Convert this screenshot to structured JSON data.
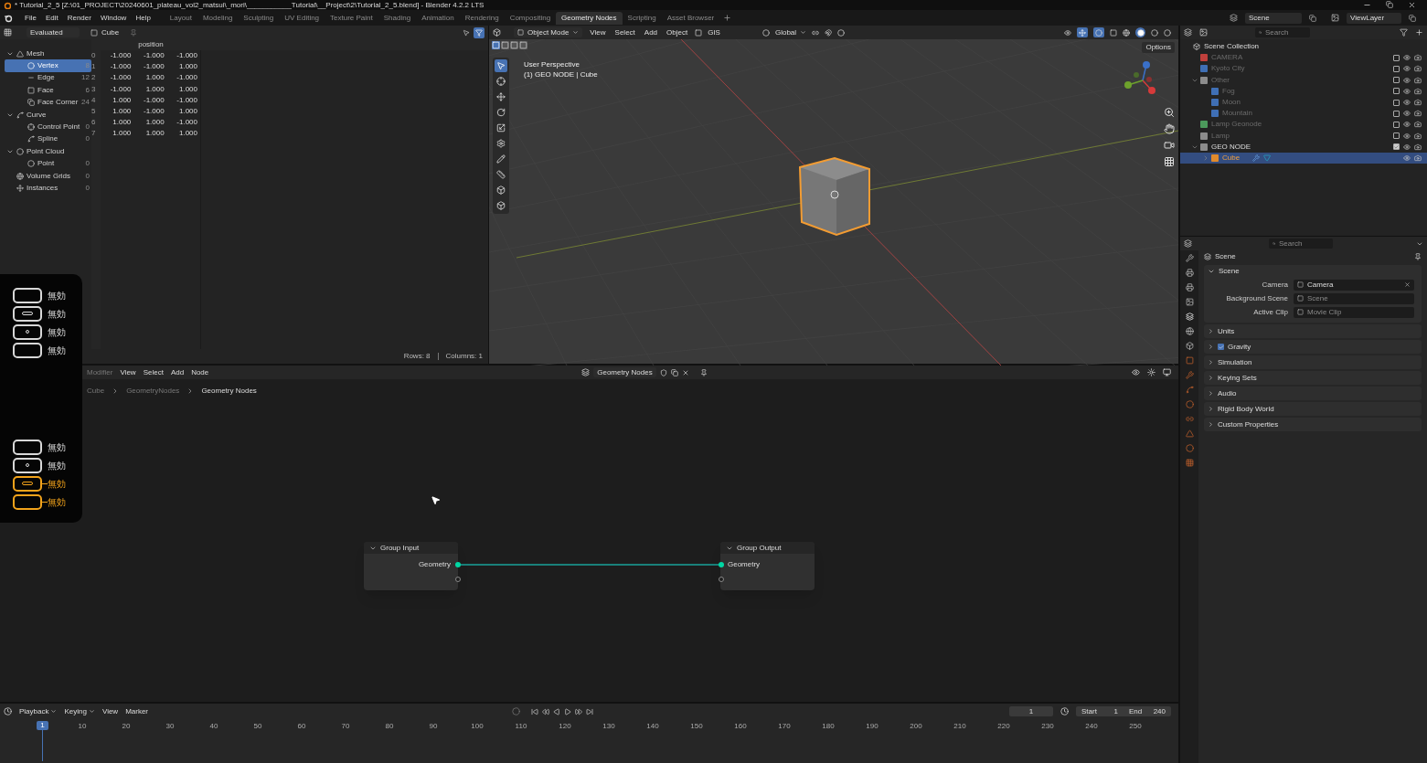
{
  "title_bar": {
    "title": "* Tutorial_2_5 [Z:\\01_PROJECT\\20240601_plateau_vol2_matsui\\_mori\\___________Tutorial\\__Project\\2\\Tutorial_2_5.blend] - Blender 4.2.2 LTS"
  },
  "menu": [
    "File",
    "Edit",
    "Render",
    "Window",
    "Help"
  ],
  "workspaces": [
    {
      "label": "Layout",
      "selected": false
    },
    {
      "label": "Modeling",
      "selected": false
    },
    {
      "label": "Sculpting",
      "selected": false
    },
    {
      "label": "UV Editing",
      "selected": false
    },
    {
      "label": "Texture Paint",
      "selected": false
    },
    {
      "label": "Shading",
      "selected": false
    },
    {
      "label": "Animation",
      "selected": false
    },
    {
      "label": "Rendering",
      "selected": false
    },
    {
      "label": "Compositing",
      "selected": false
    },
    {
      "label": "Geometry Nodes",
      "selected": true
    },
    {
      "label": "Scripting",
      "selected": false
    },
    {
      "label": "Asset Browser",
      "selected": false
    }
  ],
  "scene_field": "Scene",
  "view_layer_field": "ViewLayer",
  "spreadsheet": {
    "mode": "Evaluated",
    "object": "Cube",
    "tree": [
      {
        "label": "Mesh",
        "kind": "mesh",
        "selected": false,
        "expanded": true,
        "children": [
          {
            "label": "Vertex",
            "kind": "vertex",
            "count": "8",
            "selected": true
          },
          {
            "label": "Edge",
            "kind": "edge",
            "count": "12",
            "selected": false
          },
          {
            "label": "Face",
            "kind": "face",
            "count": "6",
            "selected": false
          },
          {
            "label": "Face Corner",
            "kind": "corner",
            "count": "24",
            "selected": false
          }
        ]
      },
      {
        "label": "Curve",
        "kind": "curve",
        "selected": false,
        "expanded": true,
        "children": [
          {
            "label": "Control Point",
            "kind": "control",
            "count": "0",
            "selected": false
          },
          {
            "label": "Spline",
            "kind": "spline",
            "count": "0",
            "selected": false
          }
        ]
      },
      {
        "label": "Point Cloud",
        "kind": "pointcloud",
        "selected": false,
        "expanded": true,
        "children": [
          {
            "label": "Point",
            "kind": "point",
            "count": "0",
            "selected": false
          }
        ]
      },
      {
        "label": "Volume Grids",
        "kind": "volume",
        "count": "0",
        "selected": false
      },
      {
        "label": "Instances",
        "kind": "instances",
        "count": "0",
        "selected": false
      }
    ],
    "column": "position",
    "rows": [
      {
        "index": "0",
        "values": [
          "-1.000",
          "-1.000",
          "-1.000"
        ]
      },
      {
        "index": "1",
        "values": [
          "-1.000",
          "-1.000",
          "1.000"
        ]
      },
      {
        "index": "2",
        "values": [
          "-1.000",
          "1.000",
          "-1.000"
        ]
      },
      {
        "index": "3",
        "values": [
          "-1.000",
          "1.000",
          "1.000"
        ]
      },
      {
        "index": "4",
        "values": [
          "1.000",
          "-1.000",
          "-1.000"
        ]
      },
      {
        "index": "5",
        "values": [
          "1.000",
          "-1.000",
          "1.000"
        ]
      },
      {
        "index": "6",
        "values": [
          "1.000",
          "1.000",
          "-1.000"
        ]
      },
      {
        "index": "7",
        "values": [
          "1.000",
          "1.000",
          "1.000"
        ]
      }
    ],
    "rows_status": "Rows: 8",
    "columns_status": "Columns: 1"
  },
  "viewport": {
    "mode": "Object Mode",
    "menus": [
      "View",
      "Select",
      "Add",
      "Object"
    ],
    "gis": "GIS",
    "orientation": "Global",
    "options": "Options",
    "info": [
      "User Perspective",
      "(1) GEO NODE | Cube"
    ]
  },
  "input_overlay": {
    "groups": [
      [
        {
          "kind": "blank",
          "label": "無効",
          "active": false
        },
        {
          "kind": "dash",
          "label": "無効",
          "active": false
        },
        {
          "kind": "dot",
          "label": "無効",
          "active": false
        },
        {
          "kind": "blank",
          "label": "無効",
          "active": false
        }
      ],
      [
        {
          "kind": "blank",
          "label": "無効",
          "active": false
        },
        {
          "kind": "dot",
          "label": "無効",
          "active": false
        },
        {
          "kind": "dash",
          "label": "無効",
          "active": true
        },
        {
          "kind": "blank",
          "label": "無効",
          "active": true
        }
      ]
    ]
  },
  "node_editor": {
    "modifier": "Modifier",
    "menus": [
      "View",
      "Select",
      "Add",
      "Node"
    ],
    "tree_name": "Geometry Nodes",
    "breadcrumb": [
      "Cube",
      "GeometryNodes",
      "Geometry Nodes"
    ],
    "nodes": [
      {
        "title": "Group Input",
        "socket": "Geometry",
        "kind": "input"
      },
      {
        "title": "Group Output",
        "socket": "Geometry",
        "kind": "output"
      }
    ]
  },
  "outliner": {
    "search_placeholder": "Search",
    "root": "Scene Collection",
    "items": [
      {
        "name": "CAMERA",
        "kind": "collection",
        "color": "#c0403c",
        "checked": false,
        "selected": false
      },
      {
        "name": "Kyoto City",
        "kind": "collection",
        "color": "#3f6fb5",
        "checked": false,
        "selected": false
      },
      {
        "name": "Other",
        "kind": "collection",
        "color": "#8c8c8c",
        "checked": false,
        "selected": false,
        "expanded": true,
        "children": [
          {
            "name": "Fog",
            "kind": "collection",
            "color": "#3f6fb5",
            "checked": false,
            "selected": false
          },
          {
            "name": "Moon",
            "kind": "collection",
            "color": "#3f6fb5",
            "checked": false,
            "selected": false
          },
          {
            "name": "Mountain",
            "kind": "collection",
            "color": "#3f6fb5",
            "checked": false,
            "selected": false
          }
        ]
      },
      {
        "name": "Lamp Geonode",
        "kind": "collection",
        "color": "#4c9a5c",
        "checked": false,
        "selected": false
      },
      {
        "name": "Lamp",
        "kind": "collection",
        "color": "#8c8c8c",
        "checked": false,
        "selected": false
      },
      {
        "name": "GEO NODE",
        "kind": "collection",
        "color": "#8c8c8c",
        "checked": true,
        "selected": false,
        "expanded": true,
        "children": [
          {
            "name": "Cube",
            "kind": "object",
            "color": "#e08a2c",
            "selected": true,
            "expanded": false
          }
        ]
      }
    ]
  },
  "properties": {
    "search_placeholder": "Search",
    "context": "Scene",
    "panel": {
      "title": "Scene",
      "expanded": true,
      "fields": [
        {
          "label": "Camera",
          "value": "Camera"
        },
        {
          "label": "Background Scene",
          "placeholder": "Scene"
        },
        {
          "label": "Active Clip",
          "placeholder": "Movie Clip"
        }
      ]
    },
    "sections": [
      {
        "title": "Units",
        "kind": "plain"
      },
      {
        "title": "Gravity",
        "kind": "checkbox",
        "checked": true
      },
      {
        "title": "Simulation",
        "kind": "plain"
      },
      {
        "title": "Keying Sets",
        "kind": "plain"
      },
      {
        "title": "Audio",
        "kind": "plain"
      },
      {
        "title": "Rigid Body World",
        "kind": "plain"
      },
      {
        "title": "Custom Properties",
        "kind": "plain"
      }
    ]
  },
  "timeline": {
    "menus": [
      {
        "label": "Playback",
        "dropdown": true
      },
      {
        "label": "Keying",
        "dropdown": true
      },
      {
        "label": "View",
        "dropdown": false
      },
      {
        "label": "Marker",
        "dropdown": false
      }
    ],
    "frame": "1",
    "start_label": "Start",
    "start": "1",
    "end_label": "End",
    "end": "240",
    "current": "1",
    "ticks": [
      "10",
      "20",
      "30",
      "40",
      "50",
      "60",
      "70",
      "80",
      "90",
      "100",
      "110",
      "120",
      "130",
      "140",
      "150",
      "160",
      "170",
      "180",
      "190",
      "200",
      "210",
      "220",
      "230",
      "240",
      "250"
    ]
  }
}
